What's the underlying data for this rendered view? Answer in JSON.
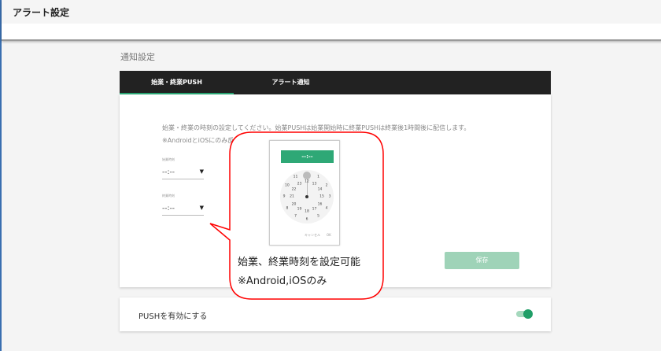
{
  "header": {
    "title": "アラート設定"
  },
  "section_title": "通知設定",
  "tabs": [
    {
      "label": "始業・終業PUSH",
      "active": true
    },
    {
      "label": "アラート通知",
      "active": false
    }
  ],
  "description": {
    "line1": "始業・終業の時刻の設定してください。始業PUSHは始業開始時に終業PUSHは終業後1時間後に配信します。",
    "line2": "※AndroidとiOSにのみ反映されます"
  },
  "start_time": {
    "label": "始業時刻",
    "value": "--:--",
    "icon": "triangle-down-icon"
  },
  "end_time": {
    "label": "終業時刻",
    "value": "--:--",
    "icon": "triangle-down-icon"
  },
  "save_label": "保存",
  "push": {
    "label": "PUSHを有効にする",
    "enabled": true
  },
  "callout": {
    "line1": "始業、終業時刻を設定可能",
    "line2": "※Android,iOSのみ"
  },
  "picker": {
    "display": "--:--",
    "outer": [
      "1",
      "2",
      "3",
      "4",
      "5",
      "6",
      "7",
      "8",
      "9",
      "10",
      "11"
    ],
    "inner": [
      "12",
      "13",
      "14",
      "15",
      "16",
      "17",
      "18",
      "19",
      "20",
      "21",
      "22",
      "23"
    ],
    "cancel": "キャンセル",
    "ok": "OK"
  },
  "colors": {
    "accent": "#2ea876",
    "callout": "#ff0000"
  }
}
